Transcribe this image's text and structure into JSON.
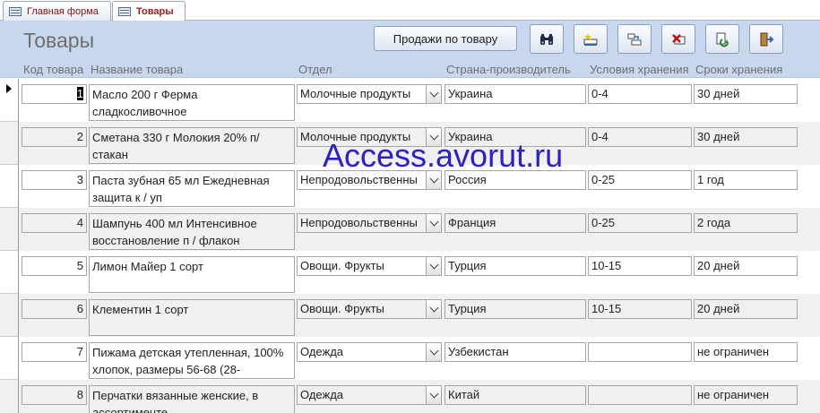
{
  "tabs": [
    {
      "label": "Главная форма",
      "active": false
    },
    {
      "label": "Товары",
      "active": true
    }
  ],
  "form": {
    "title": "Товары",
    "sales_button": "Продажи по товару",
    "toolbar_icons": [
      "binoculars-icon",
      "new-record-icon",
      "save-record-icon",
      "delete-record-icon",
      "refresh-icon",
      "exit-icon"
    ]
  },
  "columns": {
    "id": "Код товара",
    "name": "Название товара",
    "dept": "Отдел",
    "country": "Страна-производитель",
    "cond": "Условия хранения",
    "term": "Сроки хранения"
  },
  "rows": [
    {
      "id": "1",
      "name": "Масло 200 г Ферма сладкосливочное",
      "dept": "Молочные продукты",
      "country": "Украина",
      "cond": "0-4",
      "term": "30 дней",
      "current": true
    },
    {
      "id": "2",
      "name": "Сметана 330 г Молокия 20% п/стакан",
      "dept": "Молочные продукты",
      "country": "Украина",
      "cond": "0-4",
      "term": "30 дней"
    },
    {
      "id": "3",
      "name": "Паста зубная 65 мл Ежедневная защита к / уп",
      "dept": "Непродовольственны",
      "country": "Россия",
      "cond": "0-25",
      "term": "1 год"
    },
    {
      "id": "4",
      "name": "Шампунь 400 мл  Интенсивное восстановление п / флакон",
      "dept": "Непродовольственны",
      "country": "Франция",
      "cond": "0-25",
      "term": "2 года"
    },
    {
      "id": "5",
      "name": "Лимон Майер 1 сорт",
      "dept": "Овощи. Фрукты",
      "country": "Турция",
      "cond": "10-15",
      "term": "20 дней"
    },
    {
      "id": "6",
      "name": "Клементин 1 сорт",
      "dept": "Овощи. Фрукты",
      "country": "Турция",
      "cond": "10-15",
      "term": "20 дней"
    },
    {
      "id": "7",
      "name": "Пижама детская утепленная, 100% хлопок, размеры 56-68 (28-",
      "dept": "Одежда",
      "country": "Узбекистан",
      "cond": "",
      "term": "не ограничен"
    },
    {
      "id": "8",
      "name": "Перчатки вязанные женские, в ассортименте",
      "dept": "Одежда",
      "country": "Китай",
      "cond": "",
      "term": "не ограничен"
    }
  ],
  "watermark": "Access.avorut.ru"
}
